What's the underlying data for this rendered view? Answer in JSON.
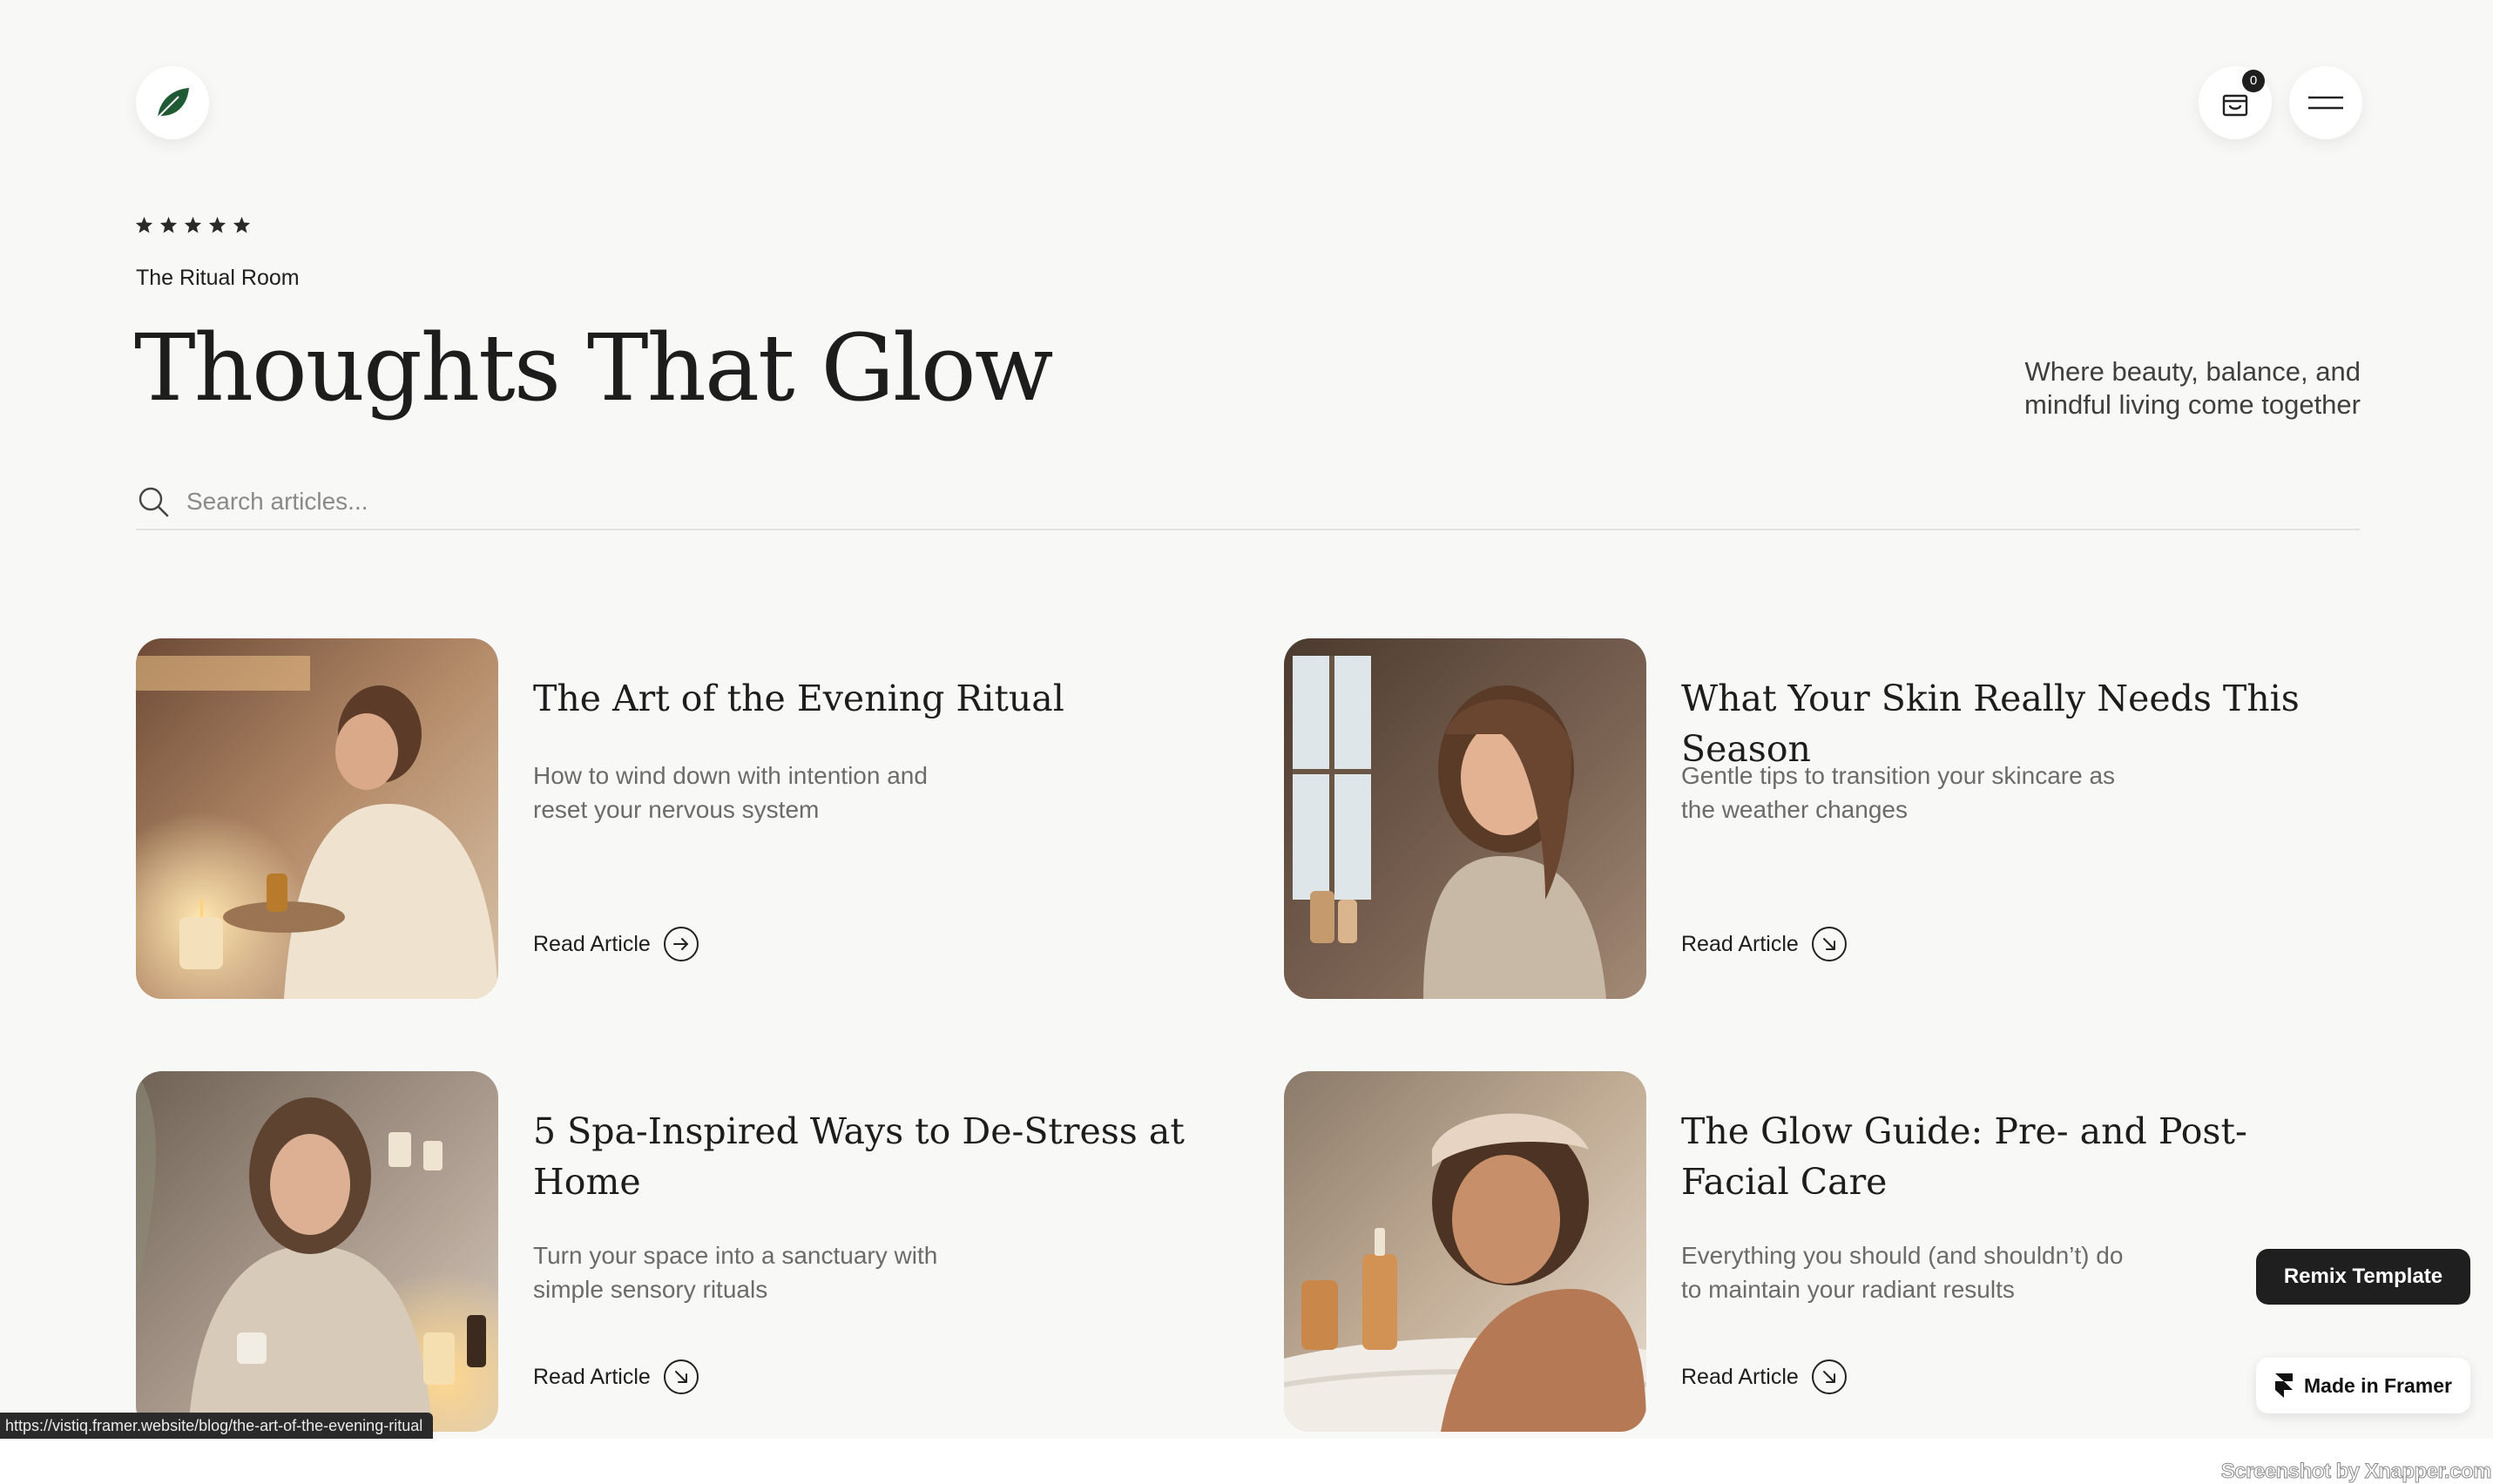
{
  "header": {
    "logo_icon": "leaf-icon",
    "cart_icon": "shopping-bag-icon",
    "cart_count": "0",
    "menu_icon": "hamburger-menu-icon"
  },
  "hero": {
    "rating": 5,
    "eyebrow": "The Ritual Room",
    "title": "Thoughts That Glow",
    "tagline_line1": "Where beauty, balance, and",
    "tagline_line2": "mindful living come together"
  },
  "search": {
    "placeholder": "Search articles...",
    "value": ""
  },
  "articles": [
    {
      "title": "The Art of the Evening Ritual",
      "description": "How to wind down with intention and reset your nervous system",
      "link_label": "Read Article",
      "link_icon": "arrow-right-circle-icon"
    },
    {
      "title": "What Your Skin Really Needs This Season",
      "description": "Gentle tips to transition your skincare as the weather changes",
      "link_label": "Read Article",
      "link_icon": "arrow-down-right-circle-icon"
    },
    {
      "title": "5 Spa-Inspired Ways to De-Stress at Home",
      "description": "Turn your space into a sanctuary with simple sensory rituals",
      "link_label": "Read Article",
      "link_icon": "arrow-down-right-circle-icon"
    },
    {
      "title": "The Glow Guide: Pre- and Post-Facial Care",
      "description": "Everything you should (and shouldn’t) do to maintain your radiant results",
      "link_label": "Read Article",
      "link_icon": "arrow-down-right-circle-icon"
    }
  ],
  "badges": {
    "remix_label": "Remix Template",
    "framer_label": "Made in Framer"
  },
  "status_bar": {
    "url": "https://vistiq.framer.website/blog/the-art-of-the-evening-ritual"
  },
  "watermark": "Screenshot by Xnapper.com",
  "colors": {
    "background": "#f8f8f7",
    "text": "#1e1e1e",
    "muted": "#6b6b6b",
    "accent_leaf": "#1f5a35",
    "button_dark": "#1f1f1f"
  }
}
